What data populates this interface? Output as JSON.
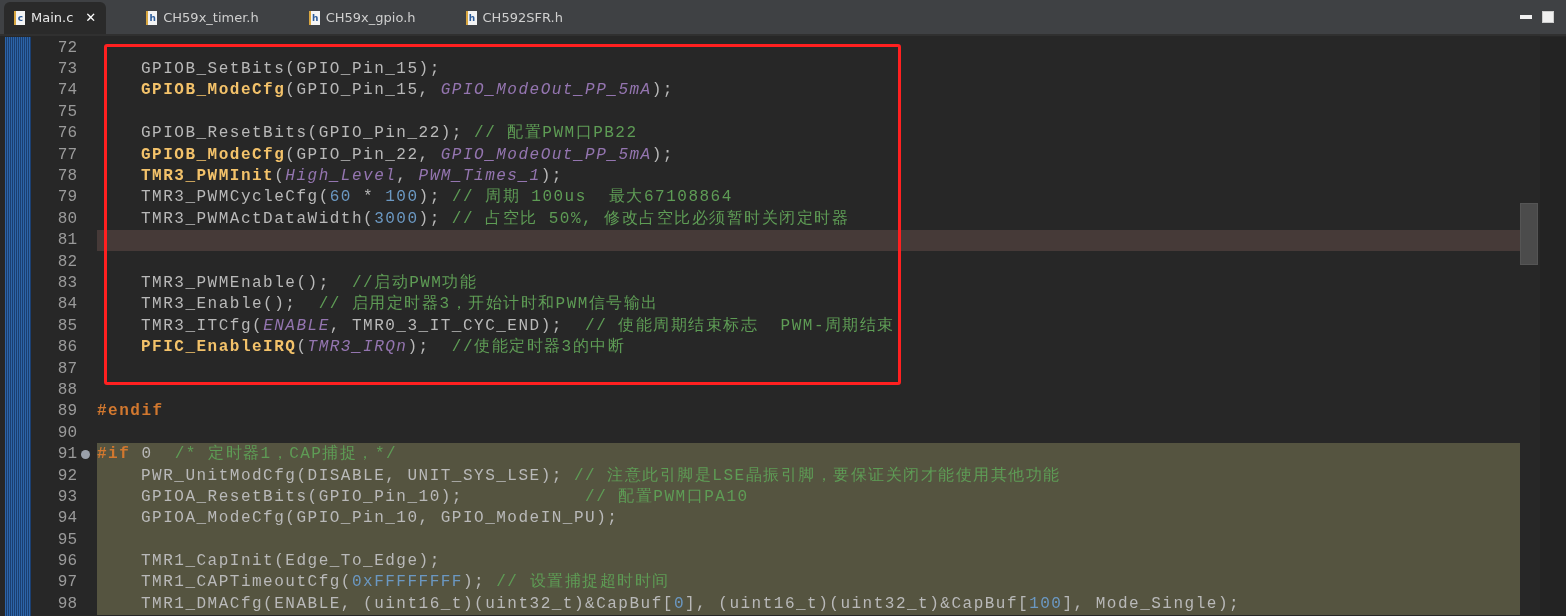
{
  "tabs": [
    {
      "icon_letter": "c",
      "label": "Main.c",
      "selected": true,
      "close": "✕"
    },
    {
      "icon_letter": "h",
      "label": "CH59x_timer.h",
      "selected": false
    },
    {
      "icon_letter": "h",
      "label": "CH59x_gpio.h",
      "selected": false
    },
    {
      "icon_letter": "h",
      "label": "CH592SFR.h",
      "selected": false
    }
  ],
  "code": {
    "lines_before": [
      {
        "number": "72",
        "current": false,
        "inactive": false,
        "marker": false
      }
    ],
    "boxed_lines": [
      {
        "number": "73",
        "indented": true,
        "current": false,
        "inactive": false,
        "marker": false,
        "tokens": [
          {
            "text": "GPIOB_SetBits(GPIO_Pin_15);",
            "kind": "plain"
          }
        ]
      },
      {
        "number": "74",
        "indented": true,
        "current": false,
        "inactive": false,
        "marker": false,
        "tokens": [
          {
            "text": "GPIOB_ModeCfg",
            "kind": "func"
          },
          {
            "text": "(GPIO_Pin_15, ",
            "kind": "plain"
          },
          {
            "text": "GPIO_ModeOut_PP_5mA",
            "kind": "const"
          },
          {
            "text": ");",
            "kind": "plain"
          }
        ]
      },
      {
        "number": "75",
        "current": false,
        "inactive": false,
        "marker": false
      },
      {
        "number": "76",
        "indented": true,
        "current": false,
        "inactive": false,
        "marker": false,
        "tokens": [
          {
            "text": "GPIOB_ResetBits(GPIO_Pin_22); ",
            "kind": "plain"
          },
          {
            "text": "// 配置PWM口PB22",
            "kind": "comment"
          }
        ]
      },
      {
        "number": "77",
        "indented": true,
        "current": false,
        "inactive": false,
        "marker": false,
        "tokens": [
          {
            "text": "GPIOB_ModeCfg",
            "kind": "func"
          },
          {
            "text": "(GPIO_Pin_22, ",
            "kind": "plain"
          },
          {
            "text": "GPIO_ModeOut_PP_5mA",
            "kind": "const"
          },
          {
            "text": ");",
            "kind": "plain"
          }
        ]
      },
      {
        "number": "78",
        "indented": true,
        "current": false,
        "inactive": false,
        "marker": false,
        "tokens": [
          {
            "text": "TMR3_PWMInit",
            "kind": "func"
          },
          {
            "text": "(",
            "kind": "plain"
          },
          {
            "text": "High_Level",
            "kind": "const"
          },
          {
            "text": ", ",
            "kind": "plain"
          },
          {
            "text": "PWM_Times_1",
            "kind": "const"
          },
          {
            "text": ");",
            "kind": "plain"
          }
        ]
      },
      {
        "number": "79",
        "indented": true,
        "current": false,
        "inactive": false,
        "marker": false,
        "tokens": [
          {
            "text": "TMR3_PWMCycleCfg(",
            "kind": "plain"
          },
          {
            "text": "60",
            "kind": "number"
          },
          {
            "text": " * ",
            "kind": "plain"
          },
          {
            "text": "100",
            "kind": "number"
          },
          {
            "text": "); ",
            "kind": "plain"
          },
          {
            "text": "// 周期 100us  最大67108864",
            "kind": "comment"
          }
        ]
      },
      {
        "number": "80",
        "indented": true,
        "current": false,
        "inactive": false,
        "marker": false,
        "tokens": [
          {
            "text": "TMR3_PWMActDataWidth(",
            "kind": "plain"
          },
          {
            "text": "3000",
            "kind": "number"
          },
          {
            "text": "); ",
            "kind": "plain"
          },
          {
            "text": "// 占空比 50%, 修改占空比必须暂时关闭定时器",
            "kind": "comment"
          }
        ]
      },
      {
        "number": "81",
        "current": true,
        "inactive": false,
        "marker": false
      },
      {
        "number": "82",
        "current": false,
        "inactive": false,
        "marker": false
      },
      {
        "number": "83",
        "indented": true,
        "current": false,
        "inactive": false,
        "marker": false,
        "tokens": [
          {
            "text": "TMR3_PWMEnable();  ",
            "kind": "plain"
          },
          {
            "text": "//启动PWM功能",
            "kind": "comment"
          }
        ]
      },
      {
        "number": "84",
        "indented": true,
        "current": false,
        "inactive": false,
        "marker": false,
        "tokens": [
          {
            "text": "TMR3_Enable();  ",
            "kind": "plain"
          },
          {
            "text": "// 启用定时器3，开始计时和PWM信号输出",
            "kind": "comment"
          }
        ]
      },
      {
        "number": "85",
        "indented": true,
        "current": false,
        "inactive": false,
        "marker": false,
        "tokens": [
          {
            "text": "TMR3_ITCfg(",
            "kind": "plain"
          },
          {
            "text": "ENABLE",
            "kind": "const"
          },
          {
            "text": ", TMR0_3_IT_CYC_END);  ",
            "kind": "plain"
          },
          {
            "text": "// 使能周期结束标志  PWM-周期结束",
            "kind": "comment"
          }
        ]
      },
      {
        "number": "86",
        "indented": true,
        "current": false,
        "inactive": false,
        "marker": false,
        "tokens": [
          {
            "text": "PFIC_EnableIRQ",
            "kind": "func"
          },
          {
            "text": "(",
            "kind": "plain"
          },
          {
            "text": "TMR3_IRQn",
            "kind": "const"
          },
          {
            "text": ");  ",
            "kind": "plain"
          },
          {
            "text": "//使能定时器3的中断",
            "kind": "comment"
          }
        ]
      },
      {
        "number": "87",
        "current": false,
        "inactive": false,
        "marker": false
      }
    ],
    "lines_after": [
      {
        "number": "88",
        "current": false,
        "inactive": false,
        "marker": false
      },
      {
        "number": "89",
        "indented": false,
        "current": false,
        "inactive": false,
        "marker": false,
        "tokens": [
          {
            "text": "#endif",
            "kind": "directive"
          }
        ]
      },
      {
        "number": "90",
        "current": false,
        "inactive": false,
        "marker": false
      },
      {
        "number": "91",
        "indented": false,
        "current": false,
        "inactive": true,
        "marker": true,
        "tokens": [
          {
            "text": "#if",
            "kind": "directive"
          },
          {
            "text": " 0  ",
            "kind": "plain"
          },
          {
            "text": "/* 定时器1，CAP捕捉，*/",
            "kind": "comment"
          }
        ]
      },
      {
        "number": "92",
        "indented": true,
        "current": false,
        "inactive": true,
        "marker": false,
        "tokens": [
          {
            "text": "PWR_UnitModCfg(DISABLE, UNIT_SYS_LSE); ",
            "kind": "plain"
          },
          {
            "text": "// 注意此引脚是LSE晶振引脚，要保证关闭才能使用其他功能",
            "kind": "comment"
          }
        ]
      },
      {
        "number": "93",
        "indented": true,
        "current": false,
        "inactive": true,
        "marker": false,
        "tokens": [
          {
            "text": "GPIOA_ResetBits(GPIO_Pin_10);           ",
            "kind": "plain"
          },
          {
            "text": "// 配置PWM口PA10",
            "kind": "comment"
          }
        ]
      },
      {
        "number": "94",
        "indented": true,
        "current": false,
        "inactive": true,
        "marker": false,
        "tokens": [
          {
            "text": "GPIOA_ModeCfg(GPIO_Pin_10, GPIO_ModeIN_PU);",
            "kind": "plain"
          }
        ]
      },
      {
        "number": "95",
        "current": false,
        "inactive": true,
        "marker": false
      },
      {
        "number": "96",
        "indented": true,
        "current": false,
        "inactive": true,
        "marker": false,
        "tokens": [
          {
            "text": "TMR1_CapInit(Edge_To_Edge);",
            "kind": "plain"
          }
        ]
      },
      {
        "number": "97",
        "indented": true,
        "current": false,
        "inactive": true,
        "marker": false,
        "tokens": [
          {
            "text": "TMR1_CAPTimeoutCfg(",
            "kind": "plain"
          },
          {
            "text": "0xFFFFFFFF",
            "kind": "number"
          },
          {
            "text": "); ",
            "kind": "plain"
          },
          {
            "text": "// 设置捕捉超时时间",
            "kind": "comment"
          }
        ]
      },
      {
        "number": "98",
        "indented": true,
        "current": false,
        "inactive": true,
        "marker": false,
        "tokens": [
          {
            "text": "TMR1_DMACfg(ENABLE, (uint16_t)(uint32_t)&CapBuf[",
            "kind": "plain"
          },
          {
            "text": "0",
            "kind": "number"
          },
          {
            "text": "], (uint16_t)(uint32_t)&CapBuf[",
            "kind": "plain"
          },
          {
            "text": "100",
            "kind": "number"
          },
          {
            "text": "], Mode_Single);",
            "kind": "plain"
          }
        ]
      }
    ]
  }
}
